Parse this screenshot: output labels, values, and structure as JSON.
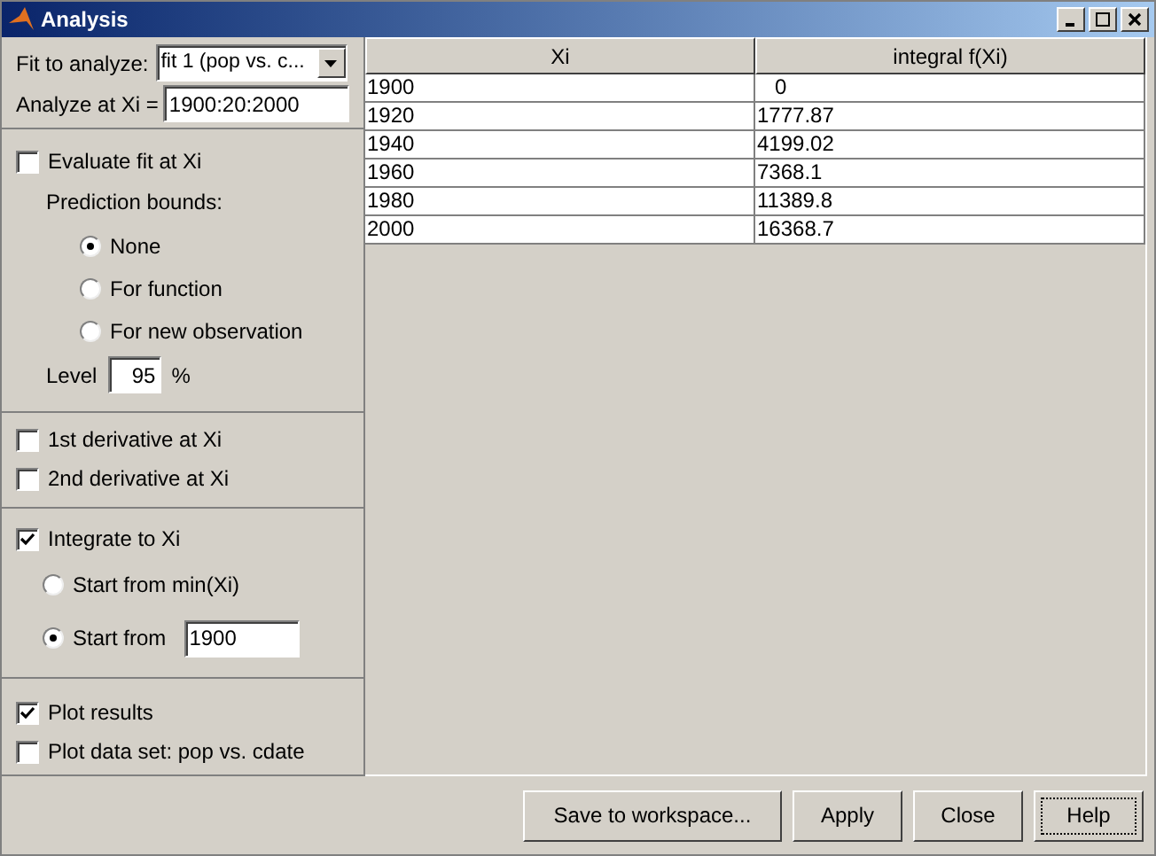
{
  "window": {
    "title": "Analysis"
  },
  "fit": {
    "label": "Fit to analyze:",
    "value": "fit 1 (pop vs. c...",
    "xi_label": "Analyze at Xi =",
    "xi_value": "1900:20:2000"
  },
  "evaluate": {
    "label": "Evaluate fit at Xi",
    "checked": false,
    "bounds_label": "Prediction bounds:",
    "bounds": [
      {
        "label": "None",
        "selected": true
      },
      {
        "label": "For function",
        "selected": false
      },
      {
        "label": "For new observation",
        "selected": false
      }
    ],
    "level_label": "Level",
    "level_value": "95",
    "level_unit": "%"
  },
  "derivatives": [
    {
      "label": "1st derivative at Xi",
      "checked": false
    },
    {
      "label": "2nd derivative at Xi",
      "checked": false
    }
  ],
  "integrate": {
    "label": "Integrate to Xi",
    "checked": true,
    "starts": [
      {
        "label": "Start from min(Xi)",
        "selected": false
      },
      {
        "label": "Start from",
        "selected": true,
        "value": "1900"
      }
    ]
  },
  "plot": [
    {
      "label": "Plot results",
      "checked": true
    },
    {
      "label": "Plot data set: pop vs. cdate",
      "checked": false
    }
  ],
  "table": {
    "columns": [
      "Xi",
      "integral f(Xi)"
    ],
    "rows": [
      [
        "1900",
        "   0"
      ],
      [
        "1920",
        "1777.87"
      ],
      [
        "1940",
        "4199.02"
      ],
      [
        "1960",
        "7368.1"
      ],
      [
        "1980",
        "11389.8"
      ],
      [
        "2000",
        "16368.7"
      ]
    ]
  },
  "buttons": [
    {
      "label": "Save to workspace...",
      "focused": false
    },
    {
      "label": "Apply",
      "focused": false
    },
    {
      "label": "Close",
      "focused": false
    },
    {
      "label": "Help",
      "focused": true
    }
  ]
}
